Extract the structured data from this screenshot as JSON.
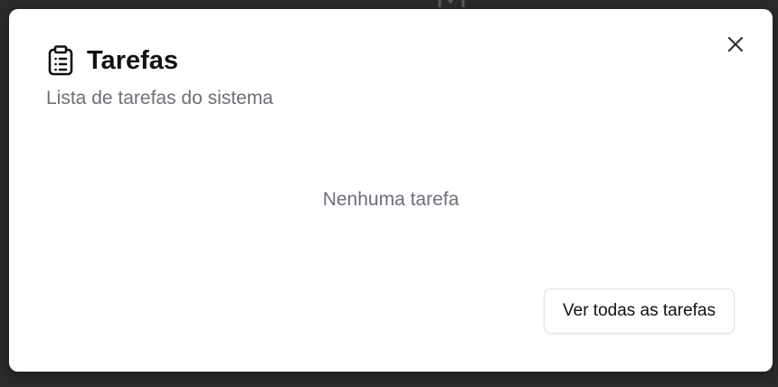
{
  "dialog": {
    "title": "Tarefas",
    "title_icon": "clipboard-list-icon",
    "subtitle": "Lista de tarefas do sistema",
    "close_icon": "close-icon",
    "empty_message": "Nenhuma tarefa",
    "view_all_label": "Ver todas as tarefas"
  },
  "colors": {
    "backdrop": "#2b2b2b",
    "dialog_bg": "#ffffff",
    "title_text": "#111111",
    "muted_text": "#6b6f7a",
    "button_border": "#e0e0e0"
  }
}
